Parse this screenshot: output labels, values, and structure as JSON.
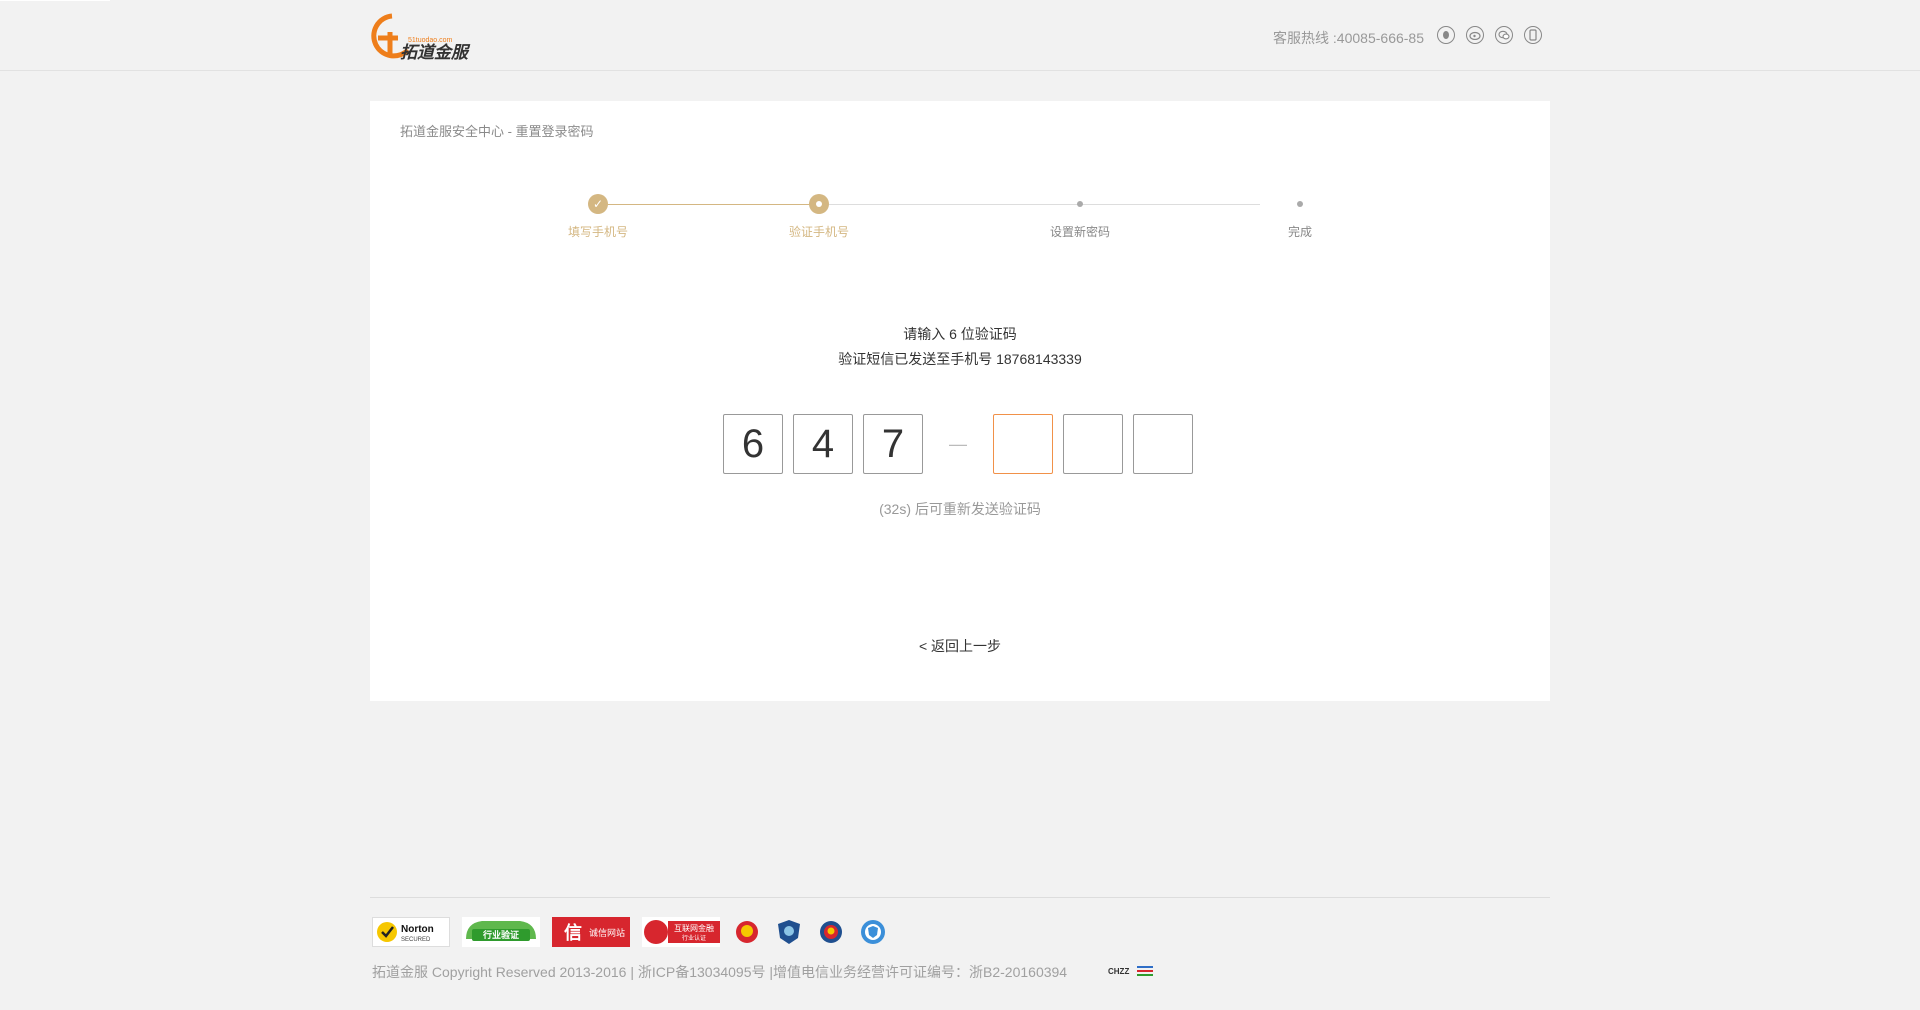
{
  "header": {
    "logo_text": "拓道金服",
    "logo_domain": "51tuodao.com",
    "hotline": "客服热线 :40085-666-85",
    "social_icons": [
      "qq-icon",
      "weibo-icon",
      "wechat-icon",
      "mobile-icon"
    ]
  },
  "card": {
    "breadcrumb": "拓道金服安全中心 - 重置登录密码",
    "steps": [
      {
        "label": "填写手机号",
        "state": "done"
      },
      {
        "label": "验证手机号",
        "state": "active"
      },
      {
        "label": "设置新密码",
        "state": "todo"
      },
      {
        "label": "完成",
        "state": "todo"
      }
    ],
    "title1": "请输入 6 位验证码",
    "title2": "验证短信已发送至手机号 18768143339",
    "codes": [
      "6",
      "4",
      "7",
      "",
      "",
      ""
    ],
    "dash": "—",
    "resend": "(32s) 后可重新发送验证码",
    "back": "< 返回上一步"
  },
  "footer": {
    "badges": [
      {
        "name": "norton-badge",
        "text": "Norton SECURED"
      },
      {
        "name": "industry-verify-badge",
        "text": "行业验证"
      },
      {
        "name": "credit-site-badge",
        "text": "诚信网站"
      },
      {
        "name": "internet-finance-badge",
        "text": "互联网金融 行业认证"
      },
      {
        "name": "police-badge-1",
        "text": ""
      },
      {
        "name": "shield-badge",
        "text": ""
      },
      {
        "name": "police-badge-2",
        "text": ""
      },
      {
        "name": "security-badge",
        "text": ""
      }
    ],
    "copyright": "拓道金服 Copyright Reserved 2013-2016 | 浙ICP备13034095号 |增值电信业务经营许可证编号：浙B2-20160394",
    "tiny_logo_1": "CHZZ",
    "colors": {
      "accent": "#d4b782",
      "focus": "#f19149",
      "brand_orange": "#ee7e1b"
    }
  }
}
